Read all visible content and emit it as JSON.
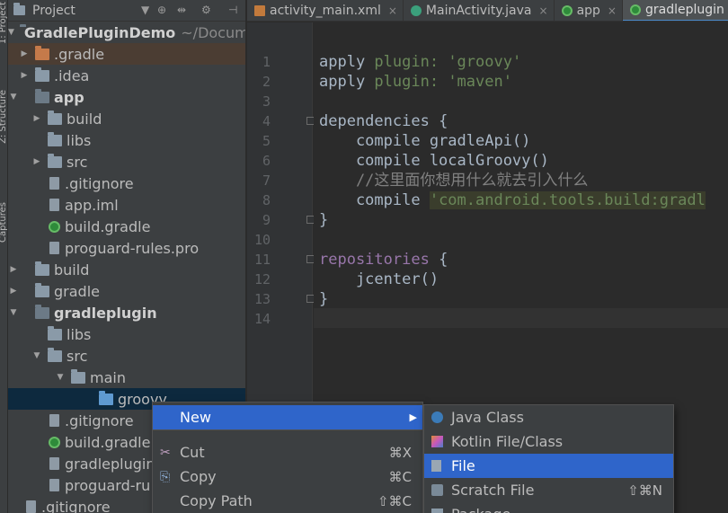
{
  "side_strip": {
    "labels": [
      "1: Project",
      "Z: Structure",
      "Captures"
    ]
  },
  "project_panel": {
    "header": {
      "title": "Project",
      "icons": [
        "dropdown-icon",
        "target-icon",
        "collapse-icon",
        "gear-icon",
        "hide-icon"
      ]
    },
    "root": {
      "name": "GradlePluginDemo",
      "path": "~/Documen"
    },
    "items": [
      {
        "label": ".gradle"
      },
      {
        "label": ".idea"
      },
      {
        "label": "app"
      },
      {
        "label": "build"
      },
      {
        "label": "libs"
      },
      {
        "label": "src"
      },
      {
        "label": ".gitignore"
      },
      {
        "label": "app.iml"
      },
      {
        "label": "build.gradle"
      },
      {
        "label": "proguard-rules.pro"
      },
      {
        "label": "build"
      },
      {
        "label": "gradle"
      },
      {
        "label": "gradleplugin"
      },
      {
        "label": "libs"
      },
      {
        "label": "src"
      },
      {
        "label": "main"
      },
      {
        "label": "groovy"
      },
      {
        "label": ".gitignore"
      },
      {
        "label": "build.gradle"
      },
      {
        "label": "gradleplugin"
      },
      {
        "label": "proguard-ru"
      },
      {
        "label": ".gitignore"
      }
    ]
  },
  "tabs": [
    {
      "label": "activity_main.xml",
      "close": "×"
    },
    {
      "label": "MainActivity.java",
      "close": "×"
    },
    {
      "label": "app",
      "close": "×"
    },
    {
      "label": "gradleplugin",
      "close": "×"
    }
  ],
  "editor": {
    "line_numbers": [
      "1",
      "2",
      "3",
      "4",
      "5",
      "6",
      "7",
      "8",
      "9",
      "10",
      "11",
      "12",
      "13",
      "14"
    ],
    "lines": [
      [
        {
          "t": "apply ",
          "c": "kw"
        },
        {
          "t": "plugin: ",
          "c": "str"
        },
        {
          "t": "'groovy'",
          "c": "str"
        }
      ],
      [
        {
          "t": "apply ",
          "c": "kw"
        },
        {
          "t": "plugin: ",
          "c": "str"
        },
        {
          "t": "'maven'",
          "c": "str"
        }
      ],
      [],
      [
        {
          "t": "dependencies ",
          "c": "kw"
        },
        {
          "t": "{",
          "c": "kw"
        }
      ],
      [
        {
          "t": "    compile gradleApi()",
          "c": "kw"
        }
      ],
      [
        {
          "t": "    compile localGroovy()",
          "c": "kw"
        }
      ],
      [
        {
          "t": "    //这里面你想用什么就去引入什么",
          "c": "cm"
        }
      ],
      [
        {
          "t": "    compile ",
          "c": "kw"
        },
        {
          "t": "'com.android.tools.build:gradl",
          "c": "str strbg"
        }
      ],
      [
        {
          "t": "}",
          "c": "kw"
        }
      ],
      [],
      [
        {
          "t": "repositories ",
          "c": "id"
        },
        {
          "t": "{",
          "c": "kw"
        }
      ],
      [
        {
          "t": "    jcenter()",
          "c": "kw"
        }
      ],
      [
        {
          "t": "}",
          "c": "kw"
        }
      ],
      []
    ]
  },
  "context_menu": {
    "items": [
      {
        "label": "New",
        "shortcut": "▶",
        "icon": ""
      },
      {
        "label": "Cut",
        "shortcut": "⌘X",
        "icon": "✂"
      },
      {
        "label": "Copy",
        "shortcut": "⌘C",
        "icon": "⎘"
      },
      {
        "label": "Copy Path",
        "shortcut": "⇧⌘C",
        "icon": ""
      }
    ]
  },
  "sub_menu": {
    "items": [
      {
        "label": "Java Class"
      },
      {
        "label": "Kotlin File/Class"
      },
      {
        "label": "File"
      },
      {
        "label": "Scratch File",
        "shortcut": "⇧⌘N"
      },
      {
        "label": "Package"
      }
    ]
  }
}
